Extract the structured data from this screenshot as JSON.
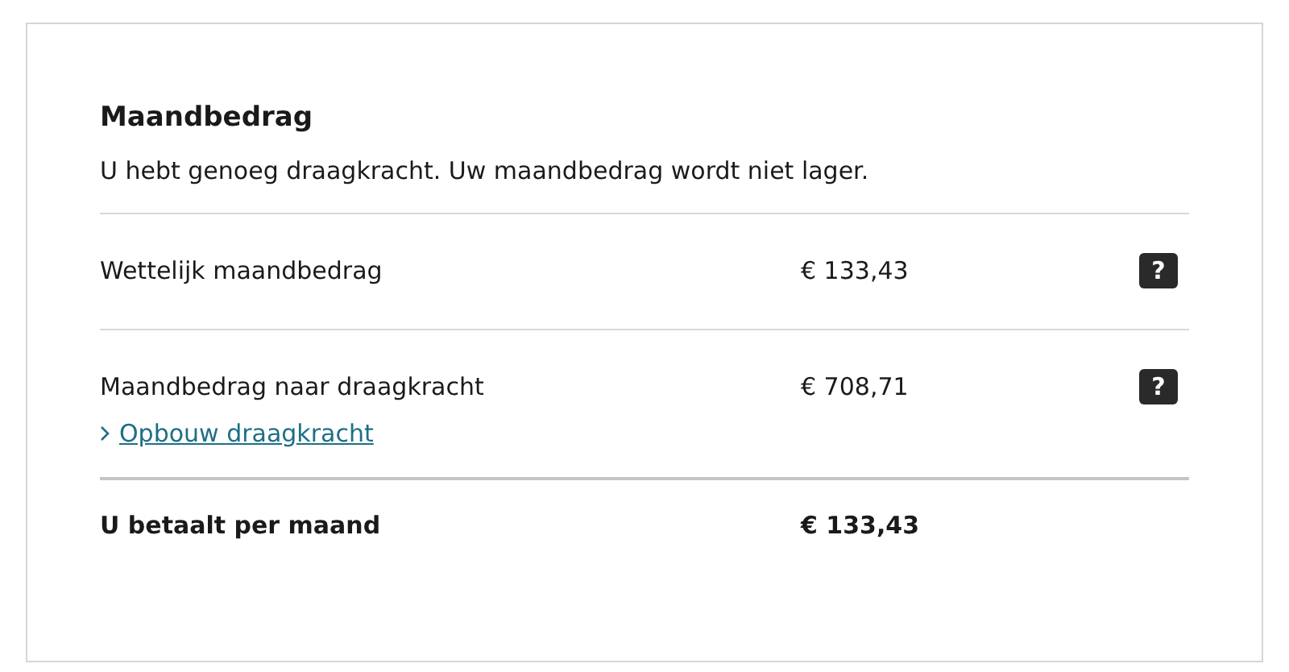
{
  "title": "Maandbedrag",
  "intro": "U hebt genoeg draagkracht. Uw maandbedrag wordt niet lager.",
  "rows": [
    {
      "label": "Wettelijk maandbedrag",
      "amount": "€ 133,43",
      "help": "?"
    },
    {
      "label": "Maandbedrag naar draagkracht",
      "amount": "€ 708,71",
      "help": "?",
      "link": "Opbouw draagkracht"
    }
  ],
  "total": {
    "label": "U betaalt per maand",
    "amount": "€ 133,43"
  }
}
